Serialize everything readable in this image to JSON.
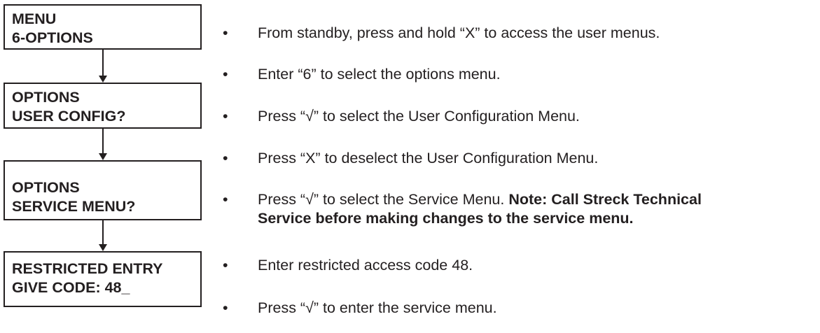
{
  "flow_boxes": [
    {
      "line1": "MENU",
      "line2": "6-OPTIONS"
    },
    {
      "line1": "OPTIONS",
      "line2": "USER CONFIG?"
    },
    {
      "line1": "OPTIONS",
      "line2": "SERVICE MENU?"
    },
    {
      "line1": "RESTRICTED ENTRY",
      "line2": "GIVE CODE: 48_"
    }
  ],
  "bullet_symbol": "•",
  "steps": [
    {
      "text": "From standby, press and hold “X” to access the user menus."
    },
    {
      "text": "Enter “6” to select the options menu."
    },
    {
      "text": "Press “√” to select the User Configuration Menu."
    },
    {
      "text": "Press “X” to deselect the User Configuration Menu."
    },
    {
      "text": "Press “√” to select the Service Menu. ",
      "note_line1": "Note:  Call Streck Technical",
      "note_line2": "Service before making changes to the service menu."
    },
    {
      "text": "Enter restricted access code 48."
    },
    {
      "text": "Press “√” to enter the service menu."
    }
  ]
}
